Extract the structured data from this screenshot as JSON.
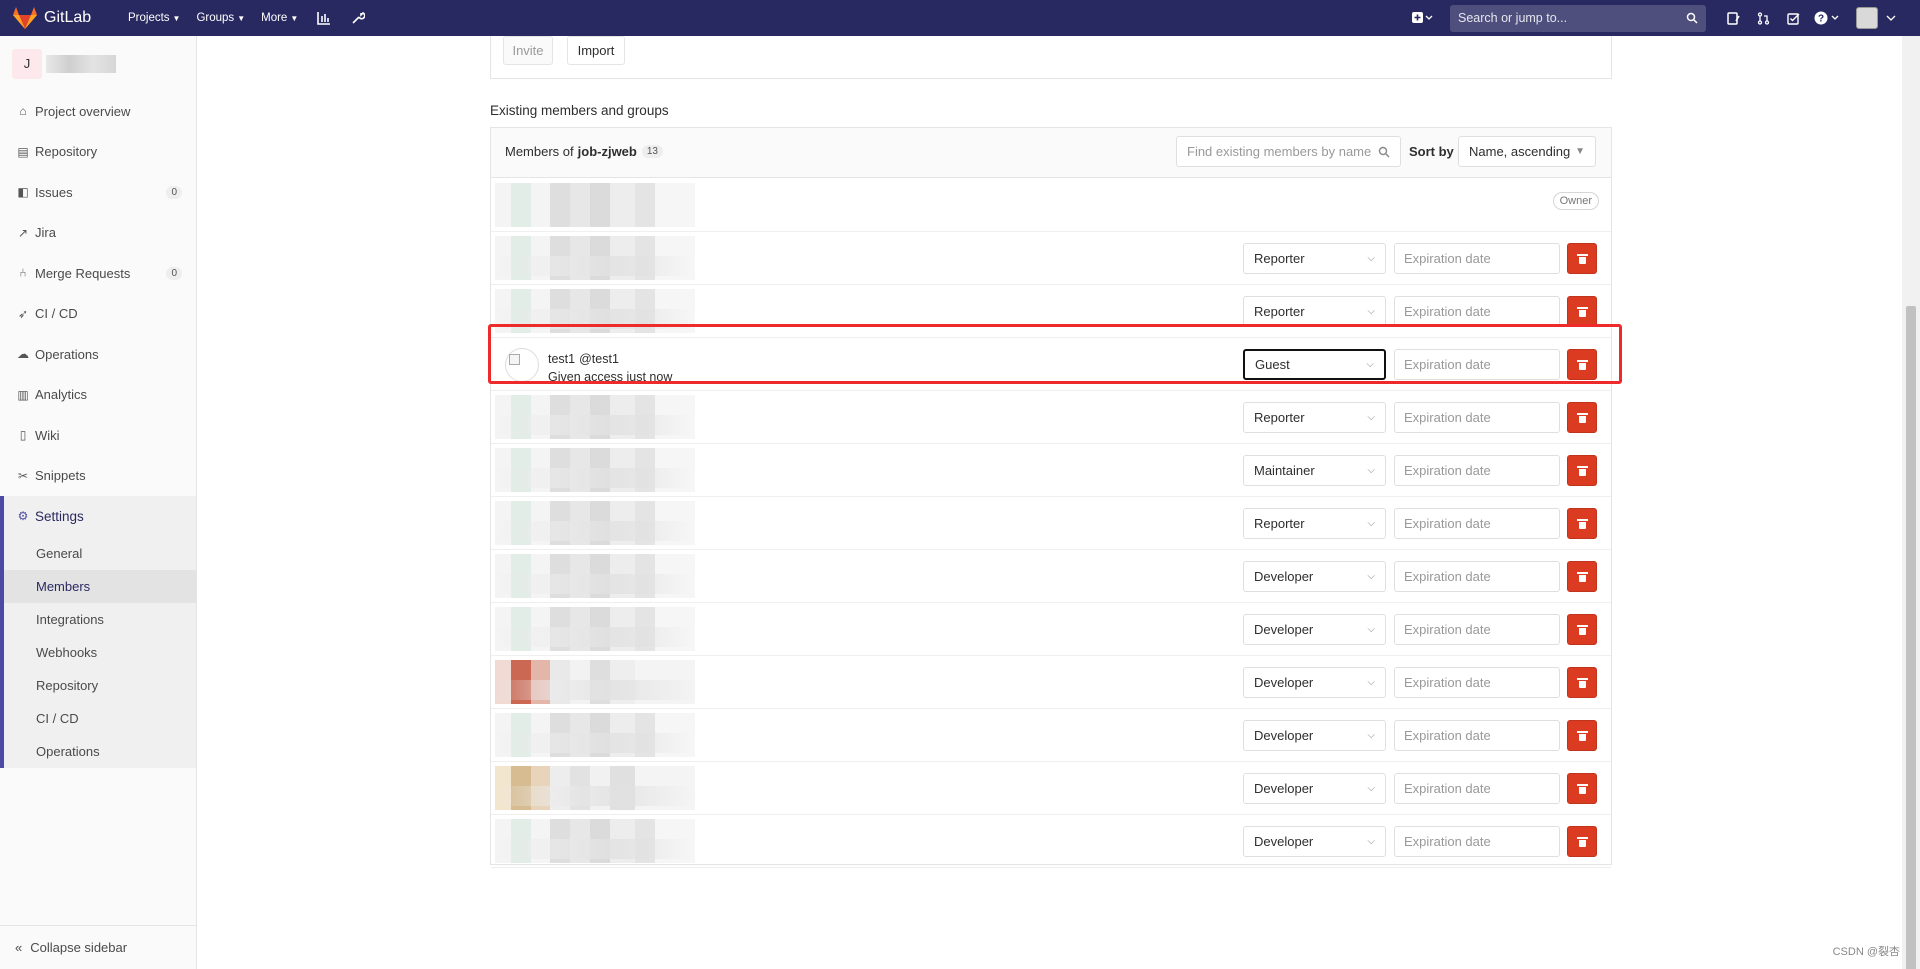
{
  "colors": {
    "navbar": "#292961",
    "delete": "#db3b21",
    "highlight": "#ee2b2b",
    "accent": "#4b4ba3"
  },
  "navbar": {
    "brand": "GitLab",
    "links": [
      {
        "label": "Projects"
      },
      {
        "label": "Groups"
      },
      {
        "label": "More"
      }
    ],
    "search_placeholder": "Search or jump to..."
  },
  "sidebar": {
    "project_initial": "J",
    "items": [
      {
        "label": "Project overview",
        "icon": "home-icon"
      },
      {
        "label": "Repository",
        "icon": "doc-icon"
      },
      {
        "label": "Issues",
        "icon": "issues-icon",
        "count": "0"
      },
      {
        "label": "Jira",
        "icon": "external-link-icon"
      },
      {
        "label": "Merge Requests",
        "icon": "merge-icon",
        "count": "0"
      },
      {
        "label": "CI / CD",
        "icon": "rocket-icon"
      },
      {
        "label": "Operations",
        "icon": "cloud-gear-icon"
      },
      {
        "label": "Analytics",
        "icon": "chart-icon"
      },
      {
        "label": "Wiki",
        "icon": "book-icon"
      },
      {
        "label": "Snippets",
        "icon": "scissors-icon"
      }
    ],
    "settings": {
      "label": "Settings",
      "sub_items": [
        "General",
        "Members",
        "Integrations",
        "Webhooks",
        "Repository",
        "CI / CD",
        "Operations"
      ]
    },
    "collapse_label": "Collapse sidebar"
  },
  "invite": {
    "invite_label": "Invite",
    "import_label": "Import"
  },
  "members": {
    "section_title": "Existing members and groups",
    "header_prefix": "Members of",
    "project": "job-zjweb",
    "count": "13",
    "find_placeholder": "Find existing members by name",
    "sort_label": "Sort by",
    "sort_value": "Name, ascending",
    "owner_badge": "Owner",
    "expiration_placeholder": "Expiration date",
    "highlighted_member": {
      "name": "test1",
      "username": "@test1",
      "status": "Given access just now"
    },
    "roles": [
      "Reporter",
      "Reporter",
      "Guest",
      "Reporter",
      "Maintainer",
      "Reporter",
      "Developer",
      "Developer",
      "Developer",
      "Developer",
      "Developer",
      "Developer"
    ]
  },
  "watermark": "CSDN @裂杏"
}
